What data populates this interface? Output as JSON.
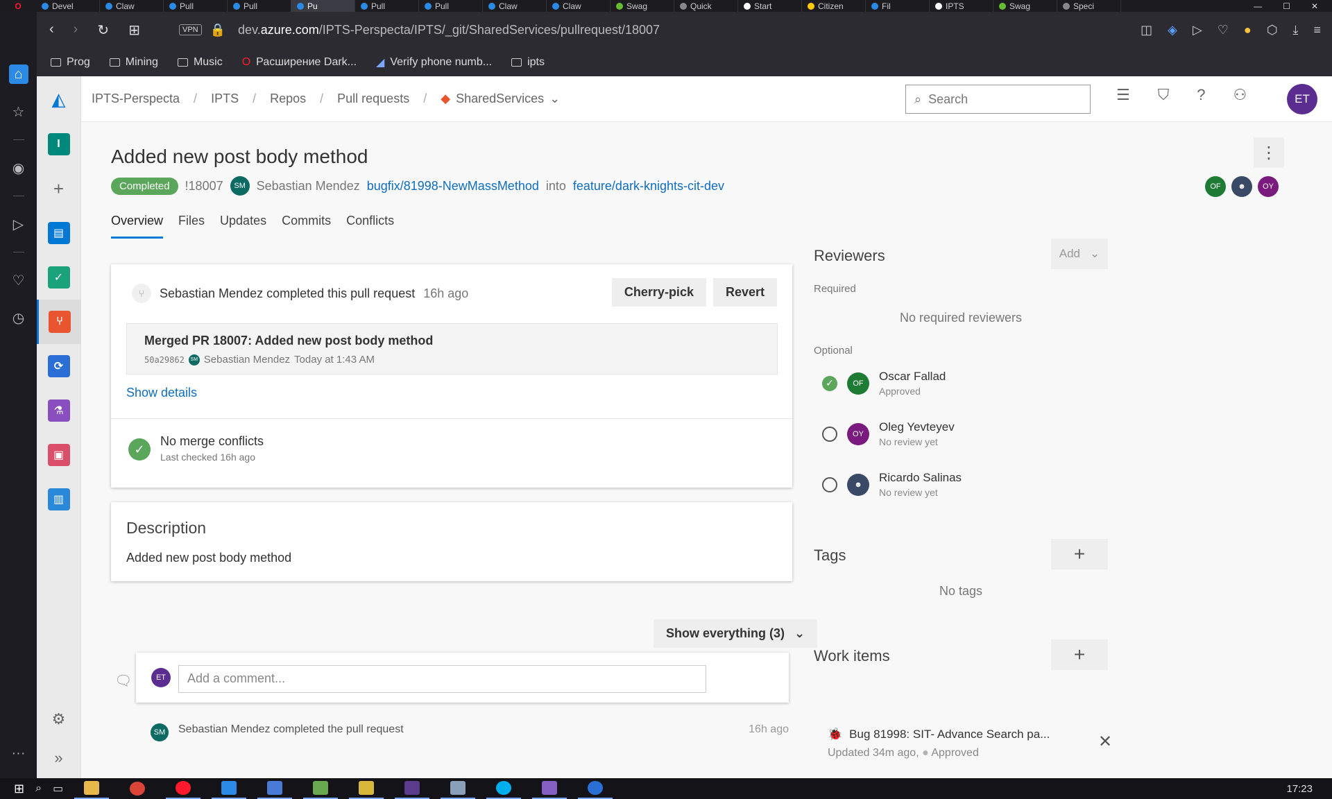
{
  "browser": {
    "tabs": [
      {
        "label": "Devel",
        "color": "#2b8ae6"
      },
      {
        "label": "Claw",
        "color": "#2b8ae6"
      },
      {
        "label": "Pull",
        "color": "#2b8ae6"
      },
      {
        "label": "Pull",
        "color": "#2b8ae6"
      },
      {
        "label": "Pu",
        "color": "#2b8ae6",
        "active": true
      },
      {
        "label": "Pull",
        "color": "#2b8ae6"
      },
      {
        "label": "Pull",
        "color": "#2b8ae6"
      },
      {
        "label": "Claw",
        "color": "#2b8ae6"
      },
      {
        "label": "Claw",
        "color": "#2b8ae6"
      },
      {
        "label": "Swag",
        "color": "#66bb33"
      },
      {
        "label": "Quick",
        "color": "#888888"
      },
      {
        "label": "Start",
        "color": "#ffffff"
      },
      {
        "label": "Citizen",
        "color": "#ffcc00"
      },
      {
        "label": "Fil",
        "color": "#2b8ae6"
      },
      {
        "label": "IPTS",
        "color": "#ffffff"
      },
      {
        "label": "Swag",
        "color": "#66bb33"
      },
      {
        "label": "Speci",
        "color": "#888888"
      }
    ],
    "vpn_label": "VPN",
    "url_prefix": "dev.",
    "url_domain": "azure.com",
    "url_path": "/IPTS-Perspecta/IPTS/_git/SharedServices/pullrequest/18007",
    "bookmarks": [
      "Prog",
      "Mining",
      "Music",
      "Расширение Dark...",
      "Verify phone numb...",
      "ipts"
    ]
  },
  "ado": {
    "breadcrumb": [
      "IPTS-Perspecta",
      "IPTS",
      "Repos",
      "Pull requests",
      "SharedServices"
    ],
    "search_placeholder": "Search",
    "user_initials": "ET",
    "nav_colors": {
      "overview": "#00897b",
      "boards": "#0078d4",
      "repos": "#e8552e",
      "pipelines": "#2b6fd6",
      "test": "#8a4fbf",
      "artifacts": "#d94f6a",
      "analytics": "#2a88d8"
    }
  },
  "pr": {
    "title": "Added new post body method",
    "status": "Completed",
    "id": "!18007",
    "author_initials": "SM",
    "author": "Sebastian Mendez",
    "source_branch": "bugfix/81998-NewMassMethod",
    "into": "into",
    "target_branch": "feature/dark-knights-cit-dev",
    "header_reviewers": [
      {
        "initials": "OF",
        "color": "#1e7b34"
      },
      {
        "initials": "",
        "color": "#3a4a66"
      },
      {
        "initials": "OY",
        "color": "#7b1a7e"
      }
    ],
    "tabs": [
      "Overview",
      "Files",
      "Updates",
      "Commits",
      "Conflicts"
    ],
    "completed_by": "Sebastian Mendez completed this pull request",
    "completed_time": "16h ago",
    "cherry_pick": "Cherry-pick",
    "revert": "Revert",
    "merge_title": "Merged PR 18007: Added new post body method",
    "merge_hash": "50a29862",
    "merge_author": "Sebastian Mendez",
    "merge_time": "Today at 1:43 AM",
    "show_details": "Show details",
    "conflicts_title": "No merge conflicts",
    "conflicts_sub": "Last checked 16h ago",
    "description_heading": "Description",
    "description_body": "Added new post body method",
    "show_everything": "Show everything (3)",
    "comment_placeholder": "Add a comment...",
    "next_activity": "Sebastian Mendez completed the pull request",
    "next_activity_time": "16h ago"
  },
  "sidebar_right": {
    "reviewers_heading": "Reviewers",
    "add_label": "Add",
    "required_label": "Required",
    "no_required": "No required reviewers",
    "optional_label": "Optional",
    "reviewers": [
      {
        "name": "Oscar Fallad",
        "status": "Approved",
        "initials": "OF",
        "color": "#1e7b34"
      },
      {
        "name": "Oleg Yevteyev",
        "status": "No review yet",
        "initials": "OY",
        "color": "#7b1a7e"
      },
      {
        "name": "Ricardo Salinas",
        "status": "No review yet",
        "initials": "",
        "color": "#3a4a66"
      }
    ],
    "tags_heading": "Tags",
    "no_tags": "No tags",
    "work_items_heading": "Work items",
    "work_item_title": "Bug 81998: SIT- Advance Search pa...",
    "work_item_updated": "Updated 34m ago,",
    "work_item_state": "Approved"
  },
  "taskbar": {
    "clock": "17:23"
  }
}
